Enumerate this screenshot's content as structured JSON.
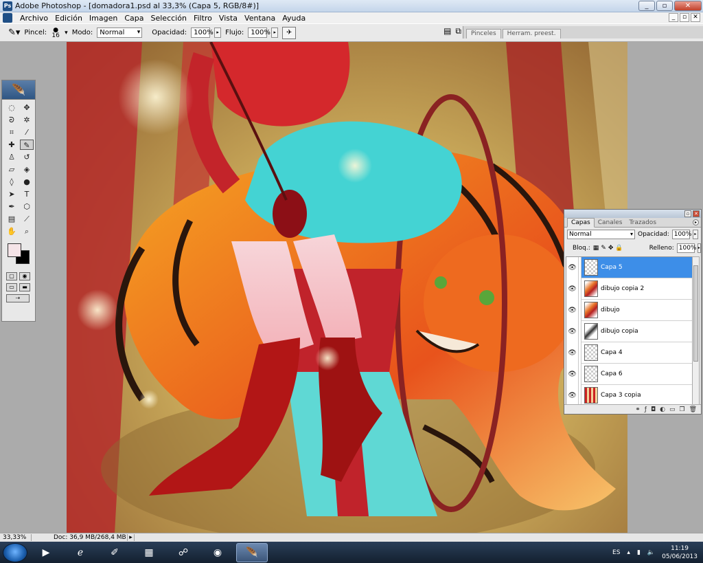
{
  "window": {
    "title": "Adobe Photoshop - [domadora1.psd al 33,3% (Capa 5, RGB/8#)]",
    "app_icon": "Ps",
    "controls": [
      "_",
      "▫",
      "✕"
    ]
  },
  "menu": [
    "Archivo",
    "Edición",
    "Imagen",
    "Capa",
    "Selección",
    "Filtro",
    "Vista",
    "Ventana",
    "Ayuda"
  ],
  "doc_controls": [
    "_",
    "▫",
    "✕"
  ],
  "options": {
    "brush_label": "Pincel:",
    "brush_size": "16",
    "mode_label": "Modo:",
    "mode_value": "Normal",
    "opacity_label": "Opacidad:",
    "opacity_value": "100%",
    "flow_label": "Flujo:",
    "flow_value": "100%"
  },
  "palette_well": {
    "tabs": [
      "Pinceles",
      "Herram. preest."
    ]
  },
  "status": {
    "zoom": "33,33%",
    "doc": "Doc: 36,9 MB/268,4 MB"
  },
  "layers_panel": {
    "tabs": [
      "Capas",
      "Canales",
      "Trazados"
    ],
    "blend_mode": "Normal",
    "opacity_label": "Opacidad:",
    "opacity_value": "100%",
    "lock_label": "Bloq.:",
    "fill_label": "Relleno:",
    "fill_value": "100%",
    "layers": [
      {
        "name": "Capa 5",
        "selected": true,
        "thumb": "empty"
      },
      {
        "name": "dibujo copia 2",
        "selected": false,
        "thumb": "art"
      },
      {
        "name": "dibujo",
        "selected": false,
        "thumb": "art"
      },
      {
        "name": "dibujo copia",
        "selected": false,
        "thumb": "sketch"
      },
      {
        "name": "Capa 4",
        "selected": false,
        "thumb": "empty"
      },
      {
        "name": "Capa 6",
        "selected": false,
        "thumb": "empty"
      },
      {
        "name": "Capa 3 copia",
        "selected": false,
        "thumb": "circus"
      }
    ]
  },
  "taskbar": {
    "language": "ES",
    "time": "11:19",
    "date": "05/06/2013"
  },
  "colors": {
    "foreground": "#f5e4e8",
    "background": "#000000",
    "selection": "#3d8ee8"
  }
}
